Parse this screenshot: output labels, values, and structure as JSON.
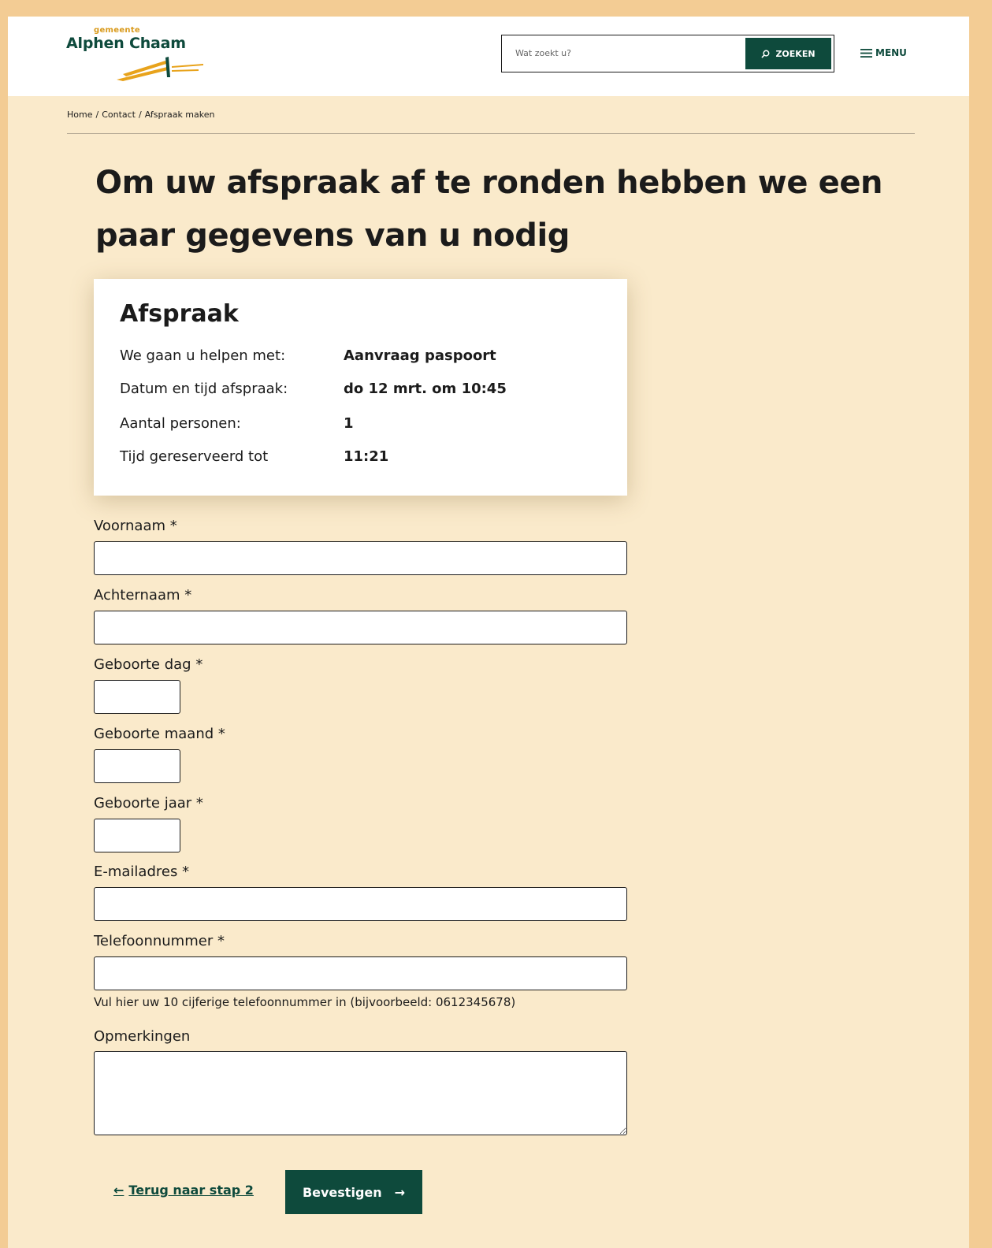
{
  "header": {
    "logo_small": "gemeente",
    "logo_main": "Alphen Chaam",
    "search_placeholder": "Wat zoekt u?",
    "search_button": "ZOEKEN",
    "menu_label": "MENU"
  },
  "breadcrumb": {
    "items": [
      "Home",
      "Contact",
      "Afspraak maken"
    ],
    "separator": "/"
  },
  "page_title": "Om uw afspraak af te ronden hebben we een paar gegevens van u nodig",
  "card": {
    "title": "Afspraak",
    "rows": [
      {
        "label": "We gaan u helpen met:",
        "value": "Aanvraag paspoort"
      },
      {
        "label": "Datum en tijd afspraak:",
        "value": "do 12 mrt. om 10:45"
      },
      {
        "label": "Aantal personen:",
        "value": "1"
      },
      {
        "label": "Tijd gereserveerd tot",
        "value": "11:21"
      }
    ]
  },
  "form": {
    "fields": [
      {
        "label": "Voornaam *",
        "value": ""
      },
      {
        "label": "Achternaam *",
        "value": ""
      },
      {
        "label": "Geboorte dag *",
        "value": ""
      },
      {
        "label": "Geboorte maand *",
        "value": ""
      },
      {
        "label": "Geboorte jaar *",
        "value": ""
      },
      {
        "label": "E-mailadres *",
        "value": ""
      },
      {
        "label": "Telefoonnummer *",
        "value": ""
      },
      {
        "label": "Opmerkingen",
        "value": ""
      }
    ],
    "phone_hint": "Vul hier uw 10 cijferige telefoonnummer in (bijvoorbeeld: 0612345678)"
  },
  "actions": {
    "back_arrow": "←",
    "back_label": "Terug naar stap 2",
    "confirm_label": "Bevestigen",
    "confirm_arrow": "→"
  },
  "colors": {
    "brand_green": "#0e4a3c",
    "brand_gold": "#d99a1c",
    "page_bg": "#faeacb",
    "outer_bg": "#f3cc94"
  },
  "icons": {
    "search": "search-icon",
    "menu": "hamburger-icon"
  }
}
